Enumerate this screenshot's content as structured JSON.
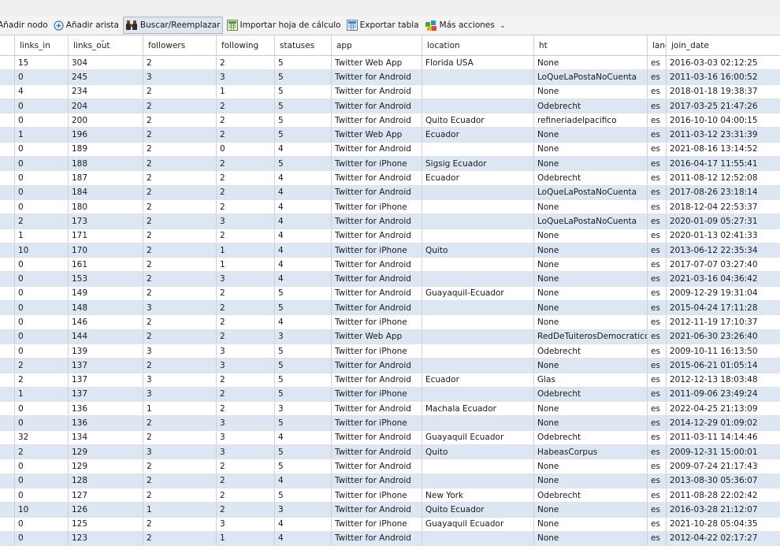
{
  "toolbar": {
    "add_node": "Añadir nodo",
    "add_edge": "Añadir arista",
    "search_replace": "Buscar/Reemplazar",
    "import_sheet": "Importar hoja de cálculo",
    "export_table": "Exportar tabla",
    "more_actions": "Más acciones"
  },
  "columns": [
    "links_in",
    "links_out",
    "followers",
    "following",
    "statuses",
    "app",
    "location",
    "ht",
    "lang",
    "join_date"
  ],
  "rows": [
    [
      "15",
      "304",
      "2",
      "2",
      "5",
      "Twitter Web App",
      "Florida  USA",
      "None",
      "es",
      "2016-03-03 02:12:25"
    ],
    [
      "0",
      "245",
      "3",
      "3",
      "5",
      "Twitter for Android",
      "",
      "LoQueLaPostaNoCuenta",
      "es",
      "2011-03-16 16:00:52"
    ],
    [
      "4",
      "234",
      "2",
      "1",
      "5",
      "Twitter for Android",
      "",
      "None",
      "es",
      "2018-01-18 19:38:37"
    ],
    [
      "0",
      "204",
      "2",
      "2",
      "5",
      "Twitter for Android",
      "",
      "Odebrecht",
      "es",
      "2017-03-25 21:47:26"
    ],
    [
      "0",
      "200",
      "2",
      "2",
      "5",
      "Twitter for Android",
      "Quito  Ecuador",
      "refineriadelpacifico",
      "es",
      "2016-10-10 04:00:15"
    ],
    [
      "1",
      "196",
      "2",
      "2",
      "5",
      "Twitter Web App",
      "Ecuador",
      "None",
      "es",
      "2011-03-12 23:31:39"
    ],
    [
      "0",
      "189",
      "2",
      "0",
      "4",
      "Twitter for Android",
      "",
      "None",
      "es",
      "2021-08-16 13:14:52"
    ],
    [
      "0",
      "188",
      "2",
      "2",
      "5",
      "Twitter for iPhone",
      "Sigsig  Ecuador",
      "None",
      "es",
      "2016-04-17 11:55:41"
    ],
    [
      "0",
      "187",
      "2",
      "2",
      "4",
      "Twitter for Android",
      "Ecuador",
      "Odebrecht",
      "es",
      "2011-08-12 12:52:08"
    ],
    [
      "0",
      "184",
      "2",
      "2",
      "4",
      "Twitter for Android",
      "",
      "LoQueLaPostaNoCuenta",
      "es",
      "2017-08-26 23:18:14"
    ],
    [
      "0",
      "180",
      "2",
      "2",
      "4",
      "Twitter for iPhone",
      "",
      "None",
      "es",
      "2018-12-04 22:53:37"
    ],
    [
      "2",
      "173",
      "2",
      "3",
      "4",
      "Twitter for Android",
      "",
      "LoQueLaPostaNoCuenta",
      "es",
      "2020-01-09 05:27:31"
    ],
    [
      "1",
      "171",
      "2",
      "2",
      "4",
      "Twitter for Android",
      "",
      "None",
      "es",
      "2020-01-13 02:41:33"
    ],
    [
      "10",
      "170",
      "2",
      "1",
      "4",
      "Twitter for iPhone",
      "Quito",
      "None",
      "es",
      "2013-06-12 22:35:34"
    ],
    [
      "0",
      "161",
      "2",
      "1",
      "4",
      "Twitter for Android",
      "",
      "None",
      "es",
      "2017-07-07 03:27:40"
    ],
    [
      "0",
      "153",
      "2",
      "3",
      "4",
      "Twitter for Android",
      "",
      "None",
      "es",
      "2021-03-16 04:36:42"
    ],
    [
      "0",
      "149",
      "2",
      "2",
      "5",
      "Twitter for Android",
      "Guayaquil-Ecuador",
      "None",
      "es",
      "2009-12-29 19:31:04"
    ],
    [
      "0",
      "148",
      "3",
      "2",
      "5",
      "Twitter for Android",
      "",
      "None",
      "es",
      "2015-04-24 17:11:28"
    ],
    [
      "0",
      "146",
      "2",
      "2",
      "4",
      "Twitter for iPhone",
      "",
      "None",
      "es",
      "2012-11-19 17:10:37"
    ],
    [
      "0",
      "144",
      "2",
      "2",
      "3",
      "Twitter Web App",
      "",
      "RedDeTuiterosDemocraticos",
      "es",
      "2021-06-30 23:26:40"
    ],
    [
      "0",
      "139",
      "3",
      "3",
      "5",
      "Twitter for iPhone",
      "",
      "Odebrecht",
      "es",
      "2009-10-11 16:13:50"
    ],
    [
      "2",
      "137",
      "2",
      "3",
      "5",
      "Twitter for Android",
      "",
      "None",
      "es",
      "2015-06-21 01:05:14"
    ],
    [
      "2",
      "137",
      "3",
      "2",
      "5",
      "Twitter for Android",
      "Ecuador",
      "Glas",
      "es",
      "2012-12-13 18:03:48"
    ],
    [
      "1",
      "137",
      "3",
      "2",
      "5",
      "Twitter for iPhone",
      "",
      "Odebrecht",
      "es",
      "2011-09-06 23:49:24"
    ],
    [
      "0",
      "136",
      "1",
      "2",
      "3",
      "Twitter for Android",
      "Machala  Ecuador",
      "None",
      "es",
      "2022-04-25 21:13:09"
    ],
    [
      "0",
      "136",
      "2",
      "3",
      "5",
      "Twitter for iPhone",
      "",
      "None",
      "es",
      "2014-12-29 01:09:02"
    ],
    [
      "32",
      "134",
      "2",
      "3",
      "4",
      "Twitter for Android",
      "Guayaquil  Ecuador",
      "Odebrecht",
      "es",
      "2011-03-11 14:14:46"
    ],
    [
      "2",
      "129",
      "3",
      "3",
      "5",
      "Twitter for Android",
      "Quito",
      "HabeasCorpus",
      "es",
      "2009-12-31 15:00:01"
    ],
    [
      "0",
      "129",
      "2",
      "2",
      "5",
      "Twitter for Android",
      "",
      "None",
      "es",
      "2009-07-24 21:17:43"
    ],
    [
      "0",
      "128",
      "2",
      "2",
      "4",
      "Twitter for Android",
      "",
      "None",
      "es",
      "2013-08-30 05:36:07"
    ],
    [
      "0",
      "127",
      "2",
      "2",
      "5",
      "Twitter for iPhone",
      "New York",
      "Odebrecht",
      "es",
      "2011-08-28 22:02:42"
    ],
    [
      "10",
      "126",
      "1",
      "2",
      "3",
      "Twitter for Android",
      "Quito  Ecuador",
      "None",
      "es",
      "2016-03-28 21:12:07"
    ],
    [
      "0",
      "125",
      "2",
      "3",
      "4",
      "Twitter for iPhone",
      "Guayaquil  Ecuador",
      "None",
      "es",
      "2021-10-28 05:04:35"
    ],
    [
      "0",
      "123",
      "2",
      "1",
      "4",
      "Twitter for Android",
      "",
      "None",
      "es",
      "2012-04-22 02:17:27"
    ]
  ],
  "colors": {
    "row_alt": "#dde7f3",
    "selected_tool": "#dfe6f0"
  }
}
